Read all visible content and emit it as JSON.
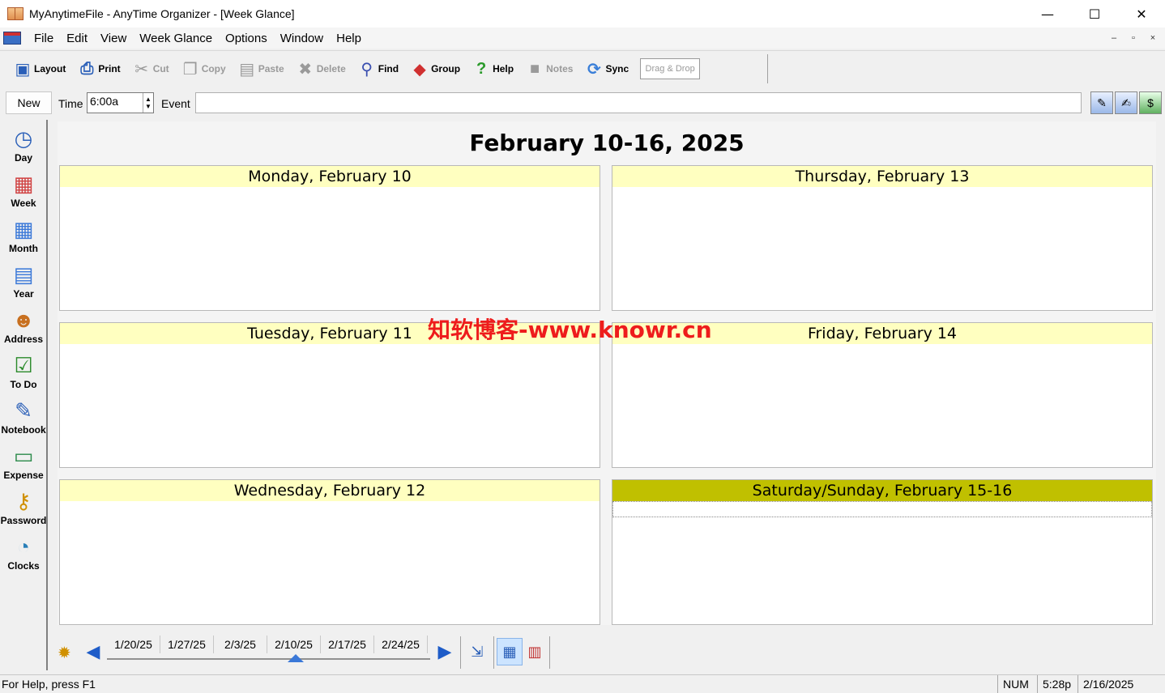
{
  "window": {
    "title": "MyAnytimeFile - AnyTime Organizer - [Week Glance]",
    "minimize": "—",
    "maximize": "☐",
    "close": "✕"
  },
  "menu": {
    "items": [
      "File",
      "Edit",
      "View",
      "Week Glance",
      "Options",
      "Window",
      "Help"
    ],
    "mdi": [
      "–",
      "▫",
      "×"
    ]
  },
  "toolbar": {
    "buttons": [
      {
        "label": "Layout",
        "icon": "layout-icon",
        "enabled": true
      },
      {
        "label": "Print",
        "icon": "print-icon",
        "enabled": true
      },
      {
        "label": "Cut",
        "icon": "cut-icon",
        "enabled": false
      },
      {
        "label": "Copy",
        "icon": "copy-icon",
        "enabled": false
      },
      {
        "label": "Paste",
        "icon": "paste-icon",
        "enabled": false
      },
      {
        "label": "Delete",
        "icon": "delete-icon",
        "enabled": false
      },
      {
        "label": "Find",
        "icon": "find-icon",
        "enabled": true
      },
      {
        "label": "Group",
        "icon": "group-icon",
        "enabled": true
      },
      {
        "label": "Help",
        "icon": "help-icon",
        "enabled": true
      },
      {
        "label": "Notes",
        "icon": "notes-icon",
        "enabled": false
      },
      {
        "label": "Sync",
        "icon": "sync-icon",
        "enabled": true
      }
    ],
    "drag_drop": "Drag & Drop"
  },
  "event_row": {
    "new_label": "New",
    "time_label": "Time",
    "time_value": "6:00a",
    "event_label": "Event",
    "event_value": ""
  },
  "sidebar": {
    "items": [
      "Day",
      "Week",
      "Month",
      "Year",
      "Address",
      "To Do",
      "Notebook",
      "Expense",
      "Password",
      "Clocks"
    ]
  },
  "week": {
    "title": "February 10-16, 2025",
    "days": [
      {
        "label": "Monday, February 10",
        "weekend": false
      },
      {
        "label": "Thursday, February 13",
        "weekend": false
      },
      {
        "label": "Tuesday, February 11",
        "weekend": false
      },
      {
        "label": "Friday, February 14",
        "weekend": false
      },
      {
        "label": "Wednesday, February 12",
        "weekend": false
      },
      {
        "label": "Saturday/Sunday, February 15-16",
        "weekend": true
      }
    ]
  },
  "week_nav": {
    "dates": [
      "1/20/25",
      "1/27/25",
      "2/3/25",
      "2/10/25",
      "2/17/25",
      "2/24/25"
    ],
    "selected": "2/10/25"
  },
  "status": {
    "help": "For Help, press F1",
    "num": "NUM",
    "time": "5:28p",
    "date": "2/16/2025"
  },
  "watermark": "知软博客-www.knowr.cn",
  "colors": {
    "day_header": "#ffffc0",
    "weekend_header": "#c0c000",
    "watermark": "#ee1c1c"
  }
}
